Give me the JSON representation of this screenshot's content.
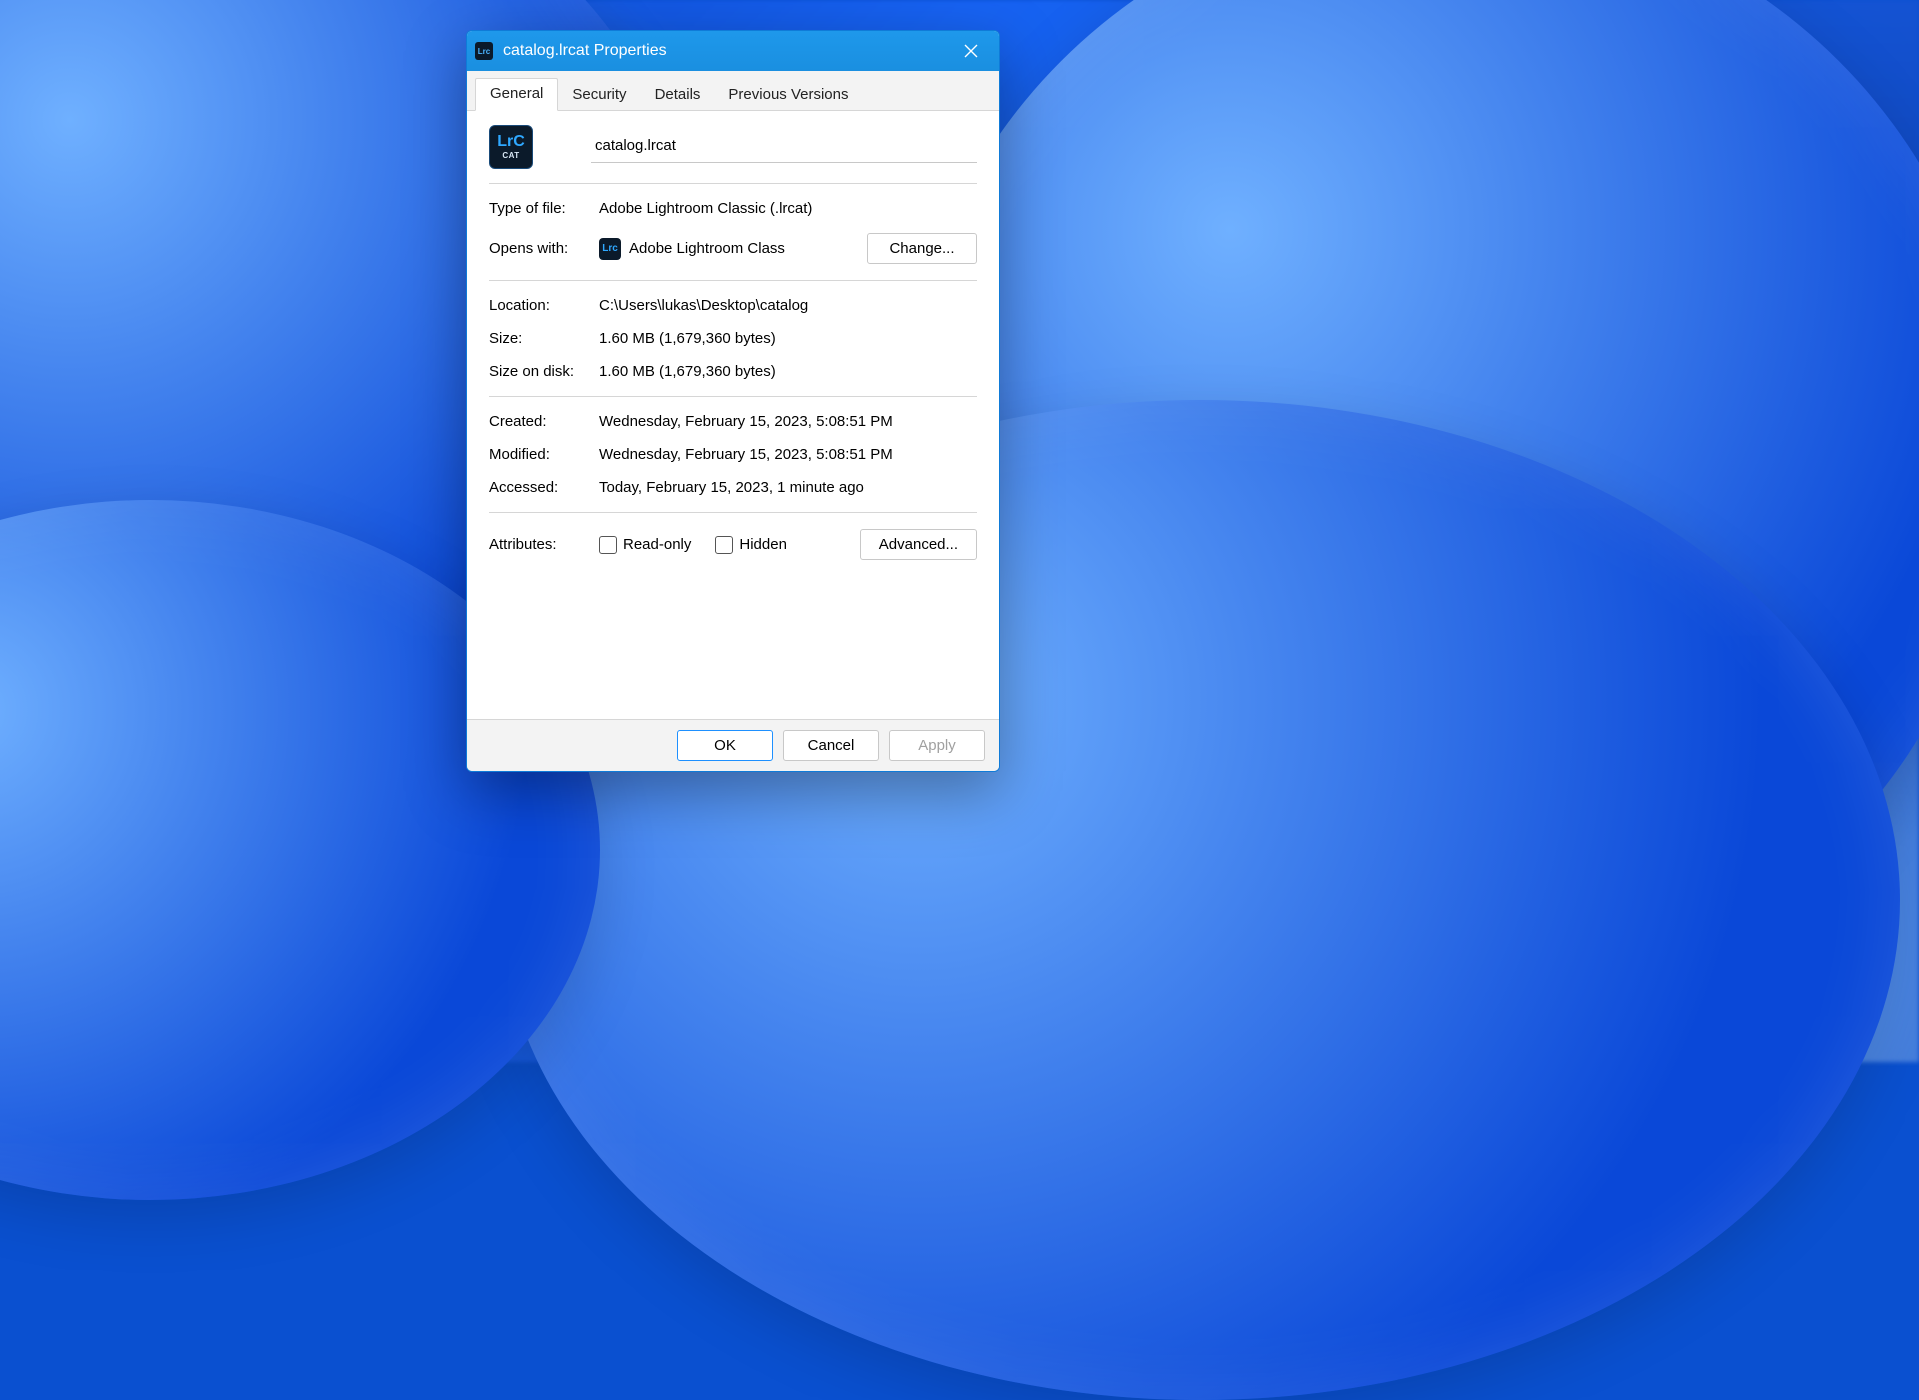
{
  "window": {
    "title": "catalog.lrcat Properties"
  },
  "tabs": {
    "general": "General",
    "security": "Security",
    "details": "Details",
    "previous": "Previous Versions"
  },
  "filename": "catalog.lrcat",
  "labels": {
    "type": "Type of file:",
    "opens": "Opens with:",
    "location": "Location:",
    "size": "Size:",
    "sizeondisk": "Size on disk:",
    "created": "Created:",
    "modified": "Modified:",
    "accessed": "Accessed:",
    "attributes": "Attributes:"
  },
  "values": {
    "type": "Adobe Lightroom Classic (.lrcat)",
    "opens": "Adobe Lightroom Class",
    "location": "C:\\Users\\lukas\\Desktop\\catalog",
    "size": "1.60 MB (1,679,360 bytes)",
    "sizeondisk": "1.60 MB (1,679,360 bytes)",
    "created": "Wednesday, February 15, 2023, 5:08:51 PM",
    "modified": "Wednesday, February 15, 2023, 5:08:51 PM",
    "accessed": "Today, February 15, 2023, 1 minute ago"
  },
  "attributes": {
    "readonly": "Read-only",
    "hidden": "Hidden"
  },
  "buttons": {
    "change": "Change...",
    "advanced": "Advanced...",
    "ok": "OK",
    "cancel": "Cancel",
    "apply": "Apply"
  },
  "icon_text": {
    "lrc": "LrC",
    "cat": "CAT",
    "small": "Lrc"
  }
}
